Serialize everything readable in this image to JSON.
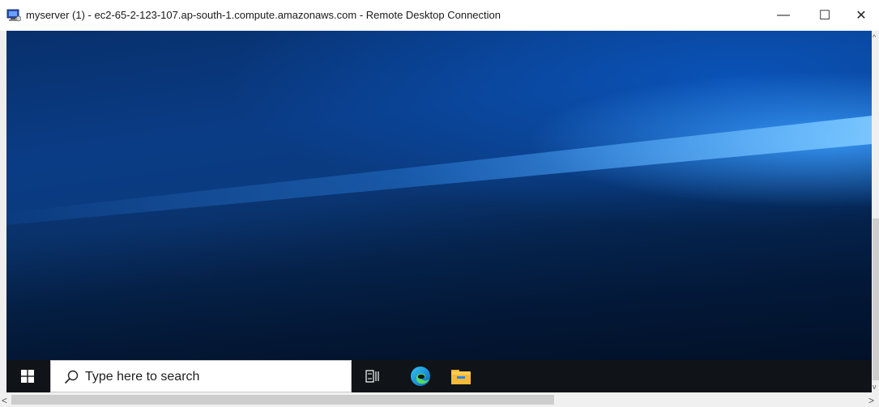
{
  "window": {
    "title": "myserver (1) - ec2-65-2-123-107.ap-south-1.compute.amazonaws.com - Remote Desktop Connection",
    "minimize_glyph": "—",
    "maximize_glyph": "☐",
    "close_glyph": "✕"
  },
  "taskbar": {
    "search": {
      "placeholder": "Type here to search"
    },
    "icons": [
      "windows-start-icon",
      "search-icon",
      "task-view-icon",
      "edge-icon",
      "file-explorer-icon"
    ]
  },
  "scrollbars": {
    "left_arrow": "<",
    "right_arrow": ">",
    "up_arrow": "^",
    "down_arrow": "v"
  },
  "colors": {
    "taskbar": "#101418",
    "wallpaper_dark": "#031a3e",
    "wallpaper_light": "#3ca0ff"
  }
}
